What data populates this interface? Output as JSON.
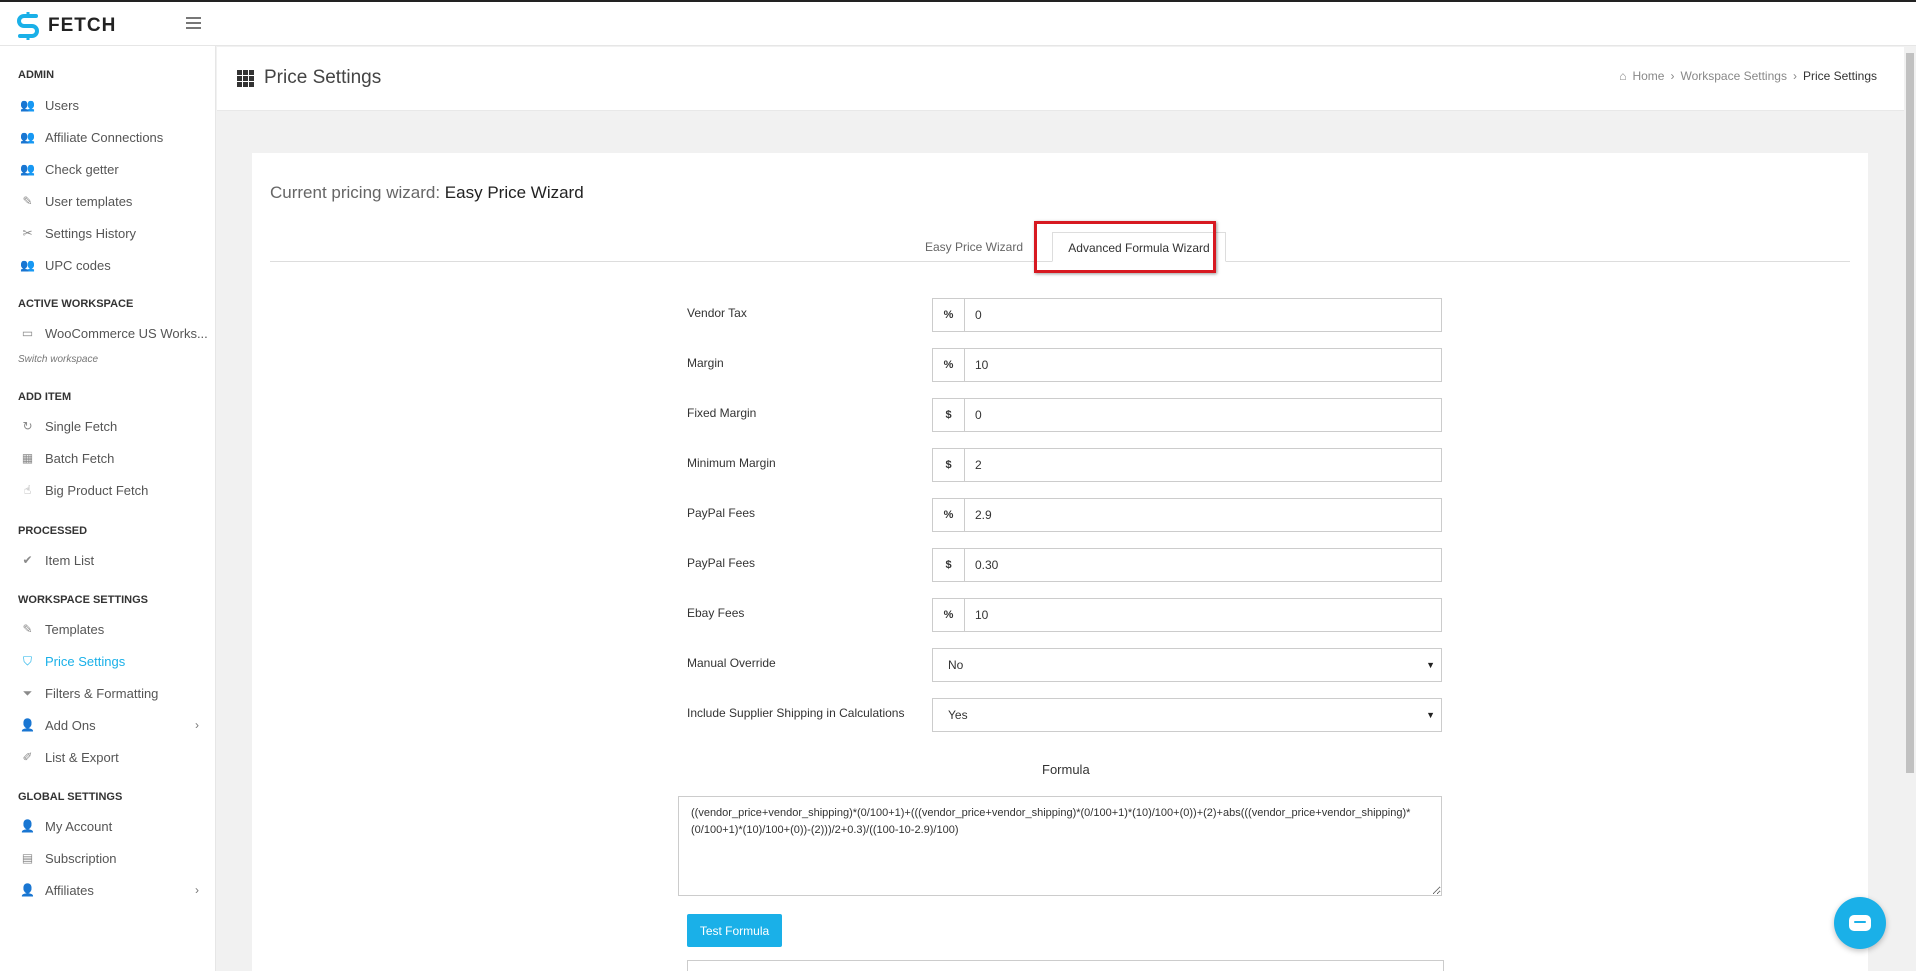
{
  "app": {
    "brand": "FETCH"
  },
  "sidebar": {
    "admin": {
      "title": "ADMIN",
      "items": [
        {
          "label": "Users",
          "icon": "users-icon"
        },
        {
          "label": "Affiliate Connections",
          "icon": "users-icon"
        },
        {
          "label": "Check getter",
          "icon": "users-icon"
        },
        {
          "label": "User templates",
          "icon": "brush-icon"
        },
        {
          "label": "Settings History",
          "icon": "wrench-icon"
        },
        {
          "label": "UPC codes",
          "icon": "users-icon"
        }
      ]
    },
    "workspace": {
      "title": "ACTIVE WORKSPACE",
      "current": "WooCommerce US Works...",
      "switch_label": "Switch workspace"
    },
    "add_item": {
      "title": "ADD ITEM",
      "items": [
        {
          "label": "Single Fetch"
        },
        {
          "label": "Batch Fetch"
        },
        {
          "label": "Big Product Fetch"
        }
      ]
    },
    "processed": {
      "title": "PROCESSED",
      "items": [
        {
          "label": "Item List"
        }
      ]
    },
    "workspace_settings": {
      "title": "WORKSPACE SETTINGS",
      "items": [
        {
          "label": "Templates"
        },
        {
          "label": "Price Settings"
        },
        {
          "label": "Filters & Formatting"
        },
        {
          "label": "Add Ons"
        },
        {
          "label": "List & Export"
        }
      ]
    },
    "global_settings": {
      "title": "GLOBAL SETTINGS",
      "items": [
        {
          "label": "My Account"
        },
        {
          "label": "Subscription"
        },
        {
          "label": "Affiliates"
        }
      ]
    }
  },
  "header": {
    "title": "Price Settings",
    "breadcrumb": [
      "Home",
      "Workspace Settings",
      "Price Settings"
    ]
  },
  "wizard": {
    "current_prefix": "Current pricing wizard:",
    "current_name": "Easy Price Wizard",
    "tabs": [
      "Easy Price Wizard",
      "Advanced Formula Wizard"
    ],
    "fields": [
      {
        "label": "Vendor Tax",
        "addon": "%",
        "value": "0"
      },
      {
        "label": "Margin",
        "addon": "%",
        "value": "10"
      },
      {
        "label": "Fixed Margin",
        "addon": "$",
        "value": "0"
      },
      {
        "label": "Minimum Margin",
        "addon": "$",
        "value": "2"
      },
      {
        "label": "PayPal Fees",
        "addon": "%",
        "value": "2.9"
      },
      {
        "label": "PayPal Fees",
        "addon": "$",
        "value": "0.30"
      },
      {
        "label": "Ebay Fees",
        "addon": "%",
        "value": "10"
      }
    ],
    "selects": [
      {
        "label": "Manual Override",
        "value": "No"
      },
      {
        "label": "Include Supplier Shipping in Calculations",
        "value": "Yes"
      }
    ],
    "formula_label": "Formula",
    "formula_value": "((vendor_price+vendor_shipping)*(0/100+1)+(((vendor_price+vendor_shipping)*(0/100+1)*(10)/100+(0))+(2)+abs(((vendor_price+vendor_shipping)*(0/100+1)*(10)/100+(0))-(2)))/2+0.3)/((100-10-2.9)/100)",
    "test_button": "Test Formula"
  },
  "colors": {
    "accent": "#1ab0e8",
    "highlight": "#d71921"
  }
}
